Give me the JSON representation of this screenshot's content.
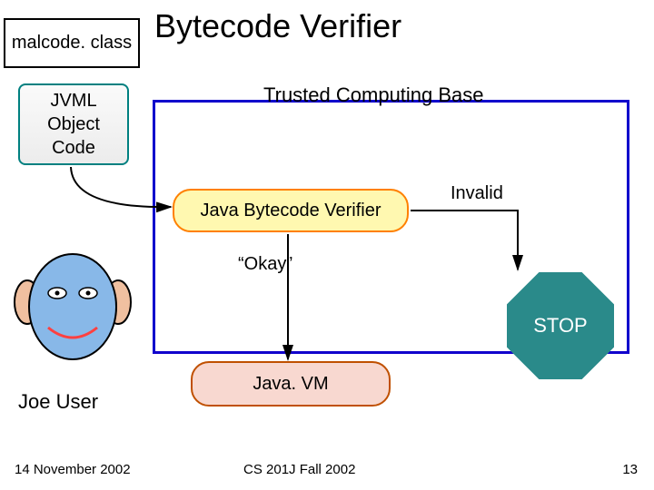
{
  "title": "Bytecode Verifier",
  "boxes": {
    "malcode": "malcode. class",
    "jvml": "JVML\nObject\nCode",
    "verifier": "Java Bytecode Verifier",
    "javavm": "Java. VM"
  },
  "labels": {
    "tcb": "Trusted Computing Base",
    "okay": "“Okay”",
    "invalid": "Invalid",
    "stop": "STOP",
    "joe_user": "Joe User"
  },
  "footer": {
    "date": "14 November 2002",
    "course": "CS 201J Fall 2002",
    "page": "13"
  },
  "colors": {
    "tcb_border": "#1000cc",
    "verifier_border": "#ff8000",
    "verifier_fill": "#fff8b0",
    "javavm_border": "#c05000",
    "javavm_fill": "#f8d8d0",
    "stop_fill": "#2a8a8a",
    "jvml_border": "#008080"
  }
}
